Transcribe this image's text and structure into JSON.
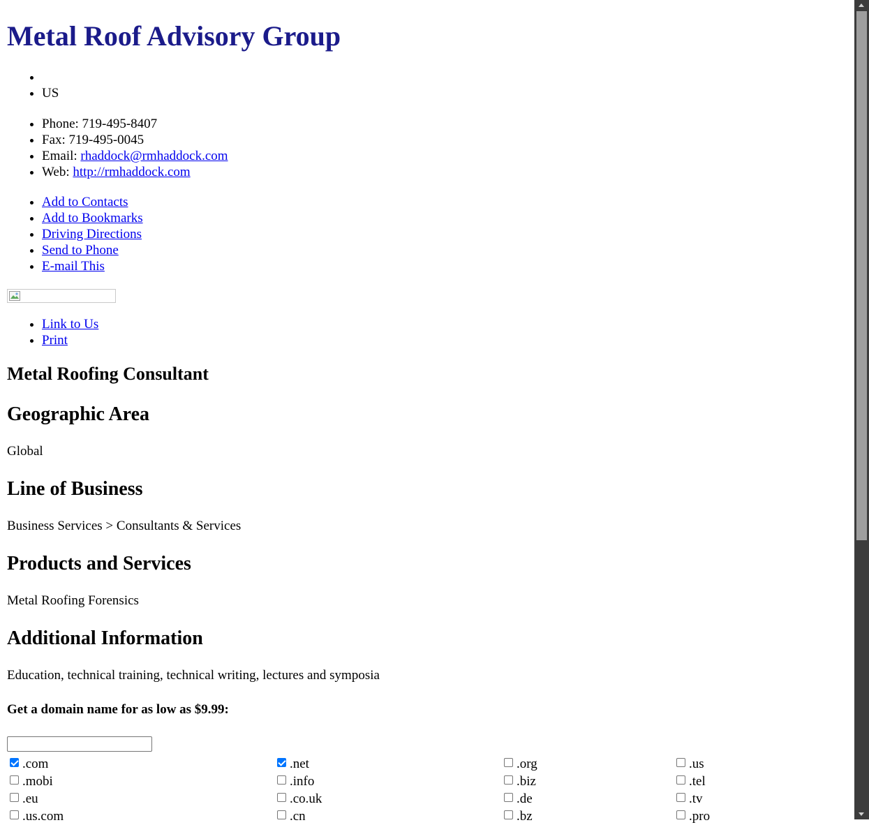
{
  "title": "Metal Roof Advisory Group",
  "address": [
    "",
    "US"
  ],
  "contact": {
    "phone_label": "Phone: ",
    "phone": "719-495-8407",
    "fax_label": "Fax: ",
    "fax": "719-495-0045",
    "email_label": "Email: ",
    "email": "rhaddock@rmhaddock.com",
    "web_label": "Web: ",
    "web": "http://rmhaddock.com"
  },
  "actions": {
    "add_contacts": "Add to Contacts",
    "add_bookmarks": "Add to Bookmarks",
    "driving_directions": "Driving Directions",
    "send_to_phone": "Send to Phone",
    "email_this": "E-mail This"
  },
  "links": {
    "link_to_us": "Link to Us",
    "print": "Print"
  },
  "sections": {
    "category": "Metal Roofing Consultant",
    "geo_heading": "Geographic Area",
    "geo_text": "Global",
    "lob_heading": "Line of Business",
    "lob_text": "Business Services > Consultants & Services",
    "ps_heading": "Products and Services",
    "ps_text": "Metal Roofing Forensics",
    "add_heading": "Additional Information",
    "add_text": "Education, technical training, technical writing, lectures and symposia"
  },
  "domain": {
    "heading": "Get a domain name for as low as $9.99:",
    "input_value": "",
    "tlds": [
      {
        "label": ".com",
        "checked": true
      },
      {
        "label": ".net",
        "checked": true
      },
      {
        "label": ".org",
        "checked": false
      },
      {
        "label": ".us",
        "checked": false
      },
      {
        "label": ".mobi",
        "checked": false
      },
      {
        "label": ".info",
        "checked": false
      },
      {
        "label": ".biz",
        "checked": false
      },
      {
        "label": ".tel",
        "checked": false
      },
      {
        "label": ".eu",
        "checked": false
      },
      {
        "label": ".co.uk",
        "checked": false
      },
      {
        "label": ".de",
        "checked": false
      },
      {
        "label": ".tv",
        "checked": false
      },
      {
        "label": ".us.com",
        "checked": false
      },
      {
        "label": ".cn",
        "checked": false
      },
      {
        "label": ".bz",
        "checked": false
      },
      {
        "label": ".pro",
        "checked": false
      }
    ]
  },
  "colors": {
    "title": "#1b1b8a",
    "link": "#0000ee",
    "checkbox_checked": "#0075ff"
  }
}
